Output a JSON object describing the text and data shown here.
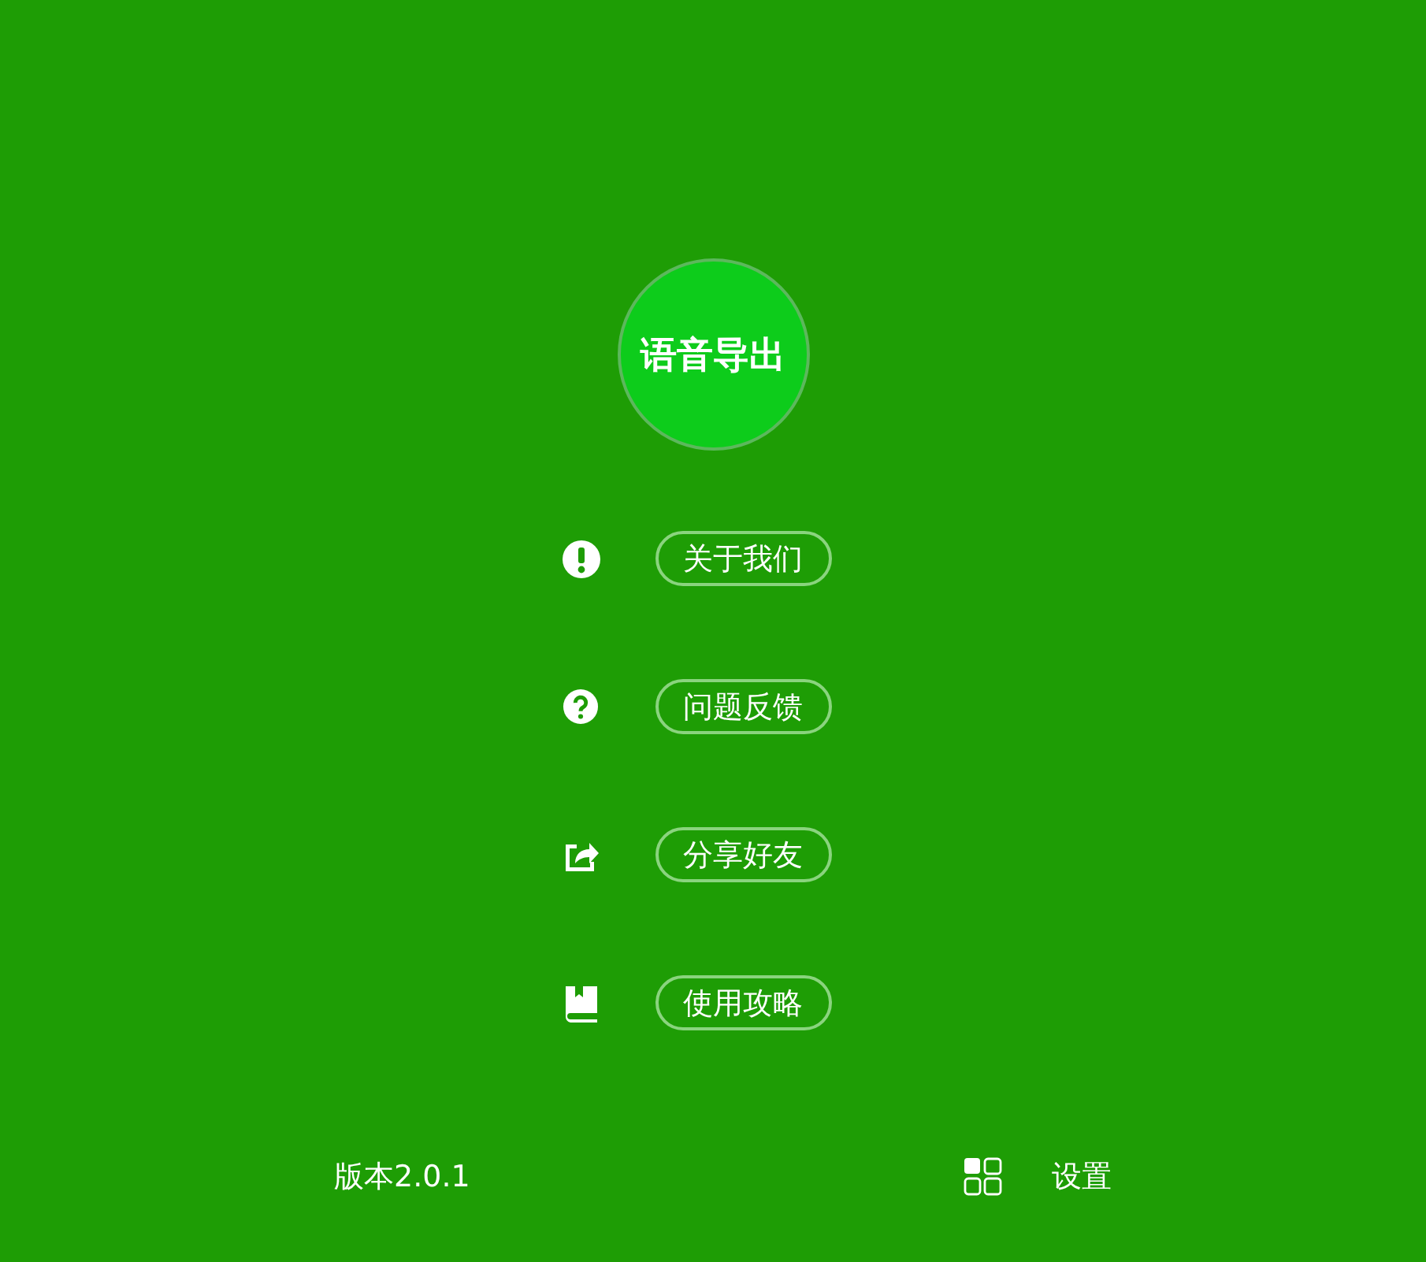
{
  "main_button": {
    "label": "语音导出"
  },
  "menu": [
    {
      "kind": "info",
      "label": "关于我们"
    },
    {
      "kind": "help",
      "label": "问题反馈"
    },
    {
      "kind": "share",
      "label": "分享好友"
    },
    {
      "kind": "book",
      "label": "使用攻略"
    }
  ],
  "footer": {
    "version": "版本2.0.1",
    "settings": "设置"
  }
}
